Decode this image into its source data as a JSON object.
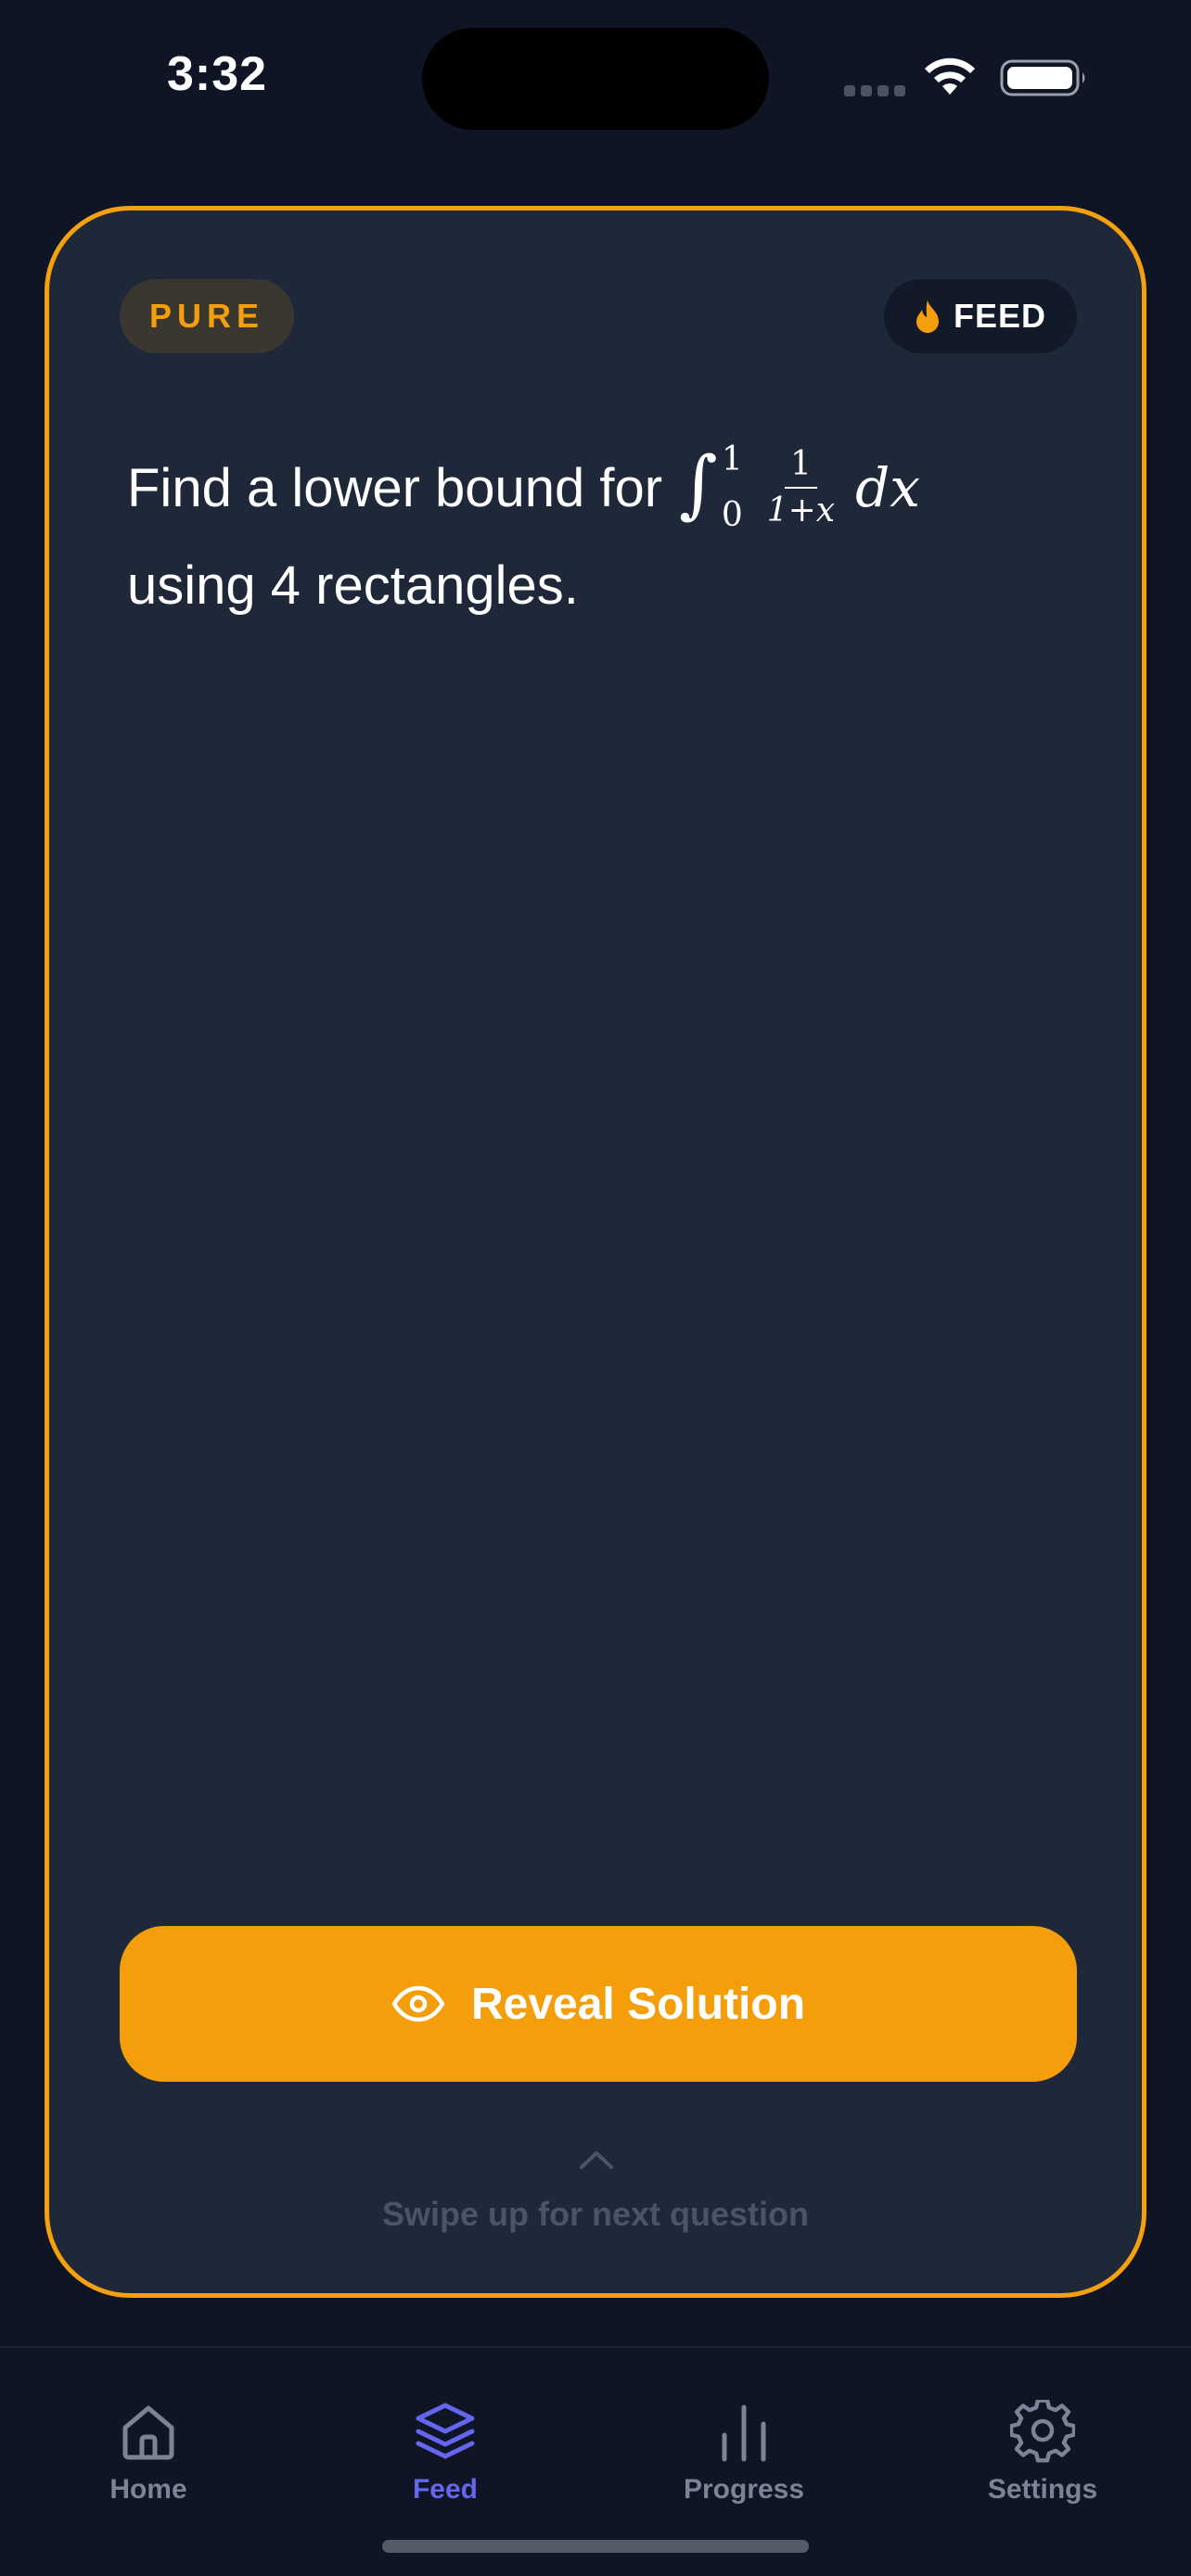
{
  "status_bar": {
    "time": "3:32"
  },
  "card": {
    "tag": "PURE",
    "feed_badge": "FEED",
    "question": {
      "prefix": "Find a lower bound for",
      "integral_symbol": "∫",
      "upper_limit": "1",
      "lower_limit": "0",
      "fraction_numerator": "1",
      "fraction_denominator": "1+x",
      "differential": "dx",
      "line2": "using 4 rectangles."
    },
    "reveal_button_label": "Reveal Solution",
    "swipe_hint": "Swipe up for next question"
  },
  "tab_bar": {
    "tabs": [
      {
        "label": "Home",
        "icon": "home-icon"
      },
      {
        "label": "Feed",
        "icon": "layers-icon"
      },
      {
        "label": "Progress",
        "icon": "bar-chart-icon"
      },
      {
        "label": "Settings",
        "icon": "gear-icon"
      }
    ],
    "active": "Feed"
  },
  "colors": {
    "accent": "#f59e0b",
    "active_tab": "#6466ee",
    "background": "#0f1525",
    "card": "#1f2839"
  }
}
